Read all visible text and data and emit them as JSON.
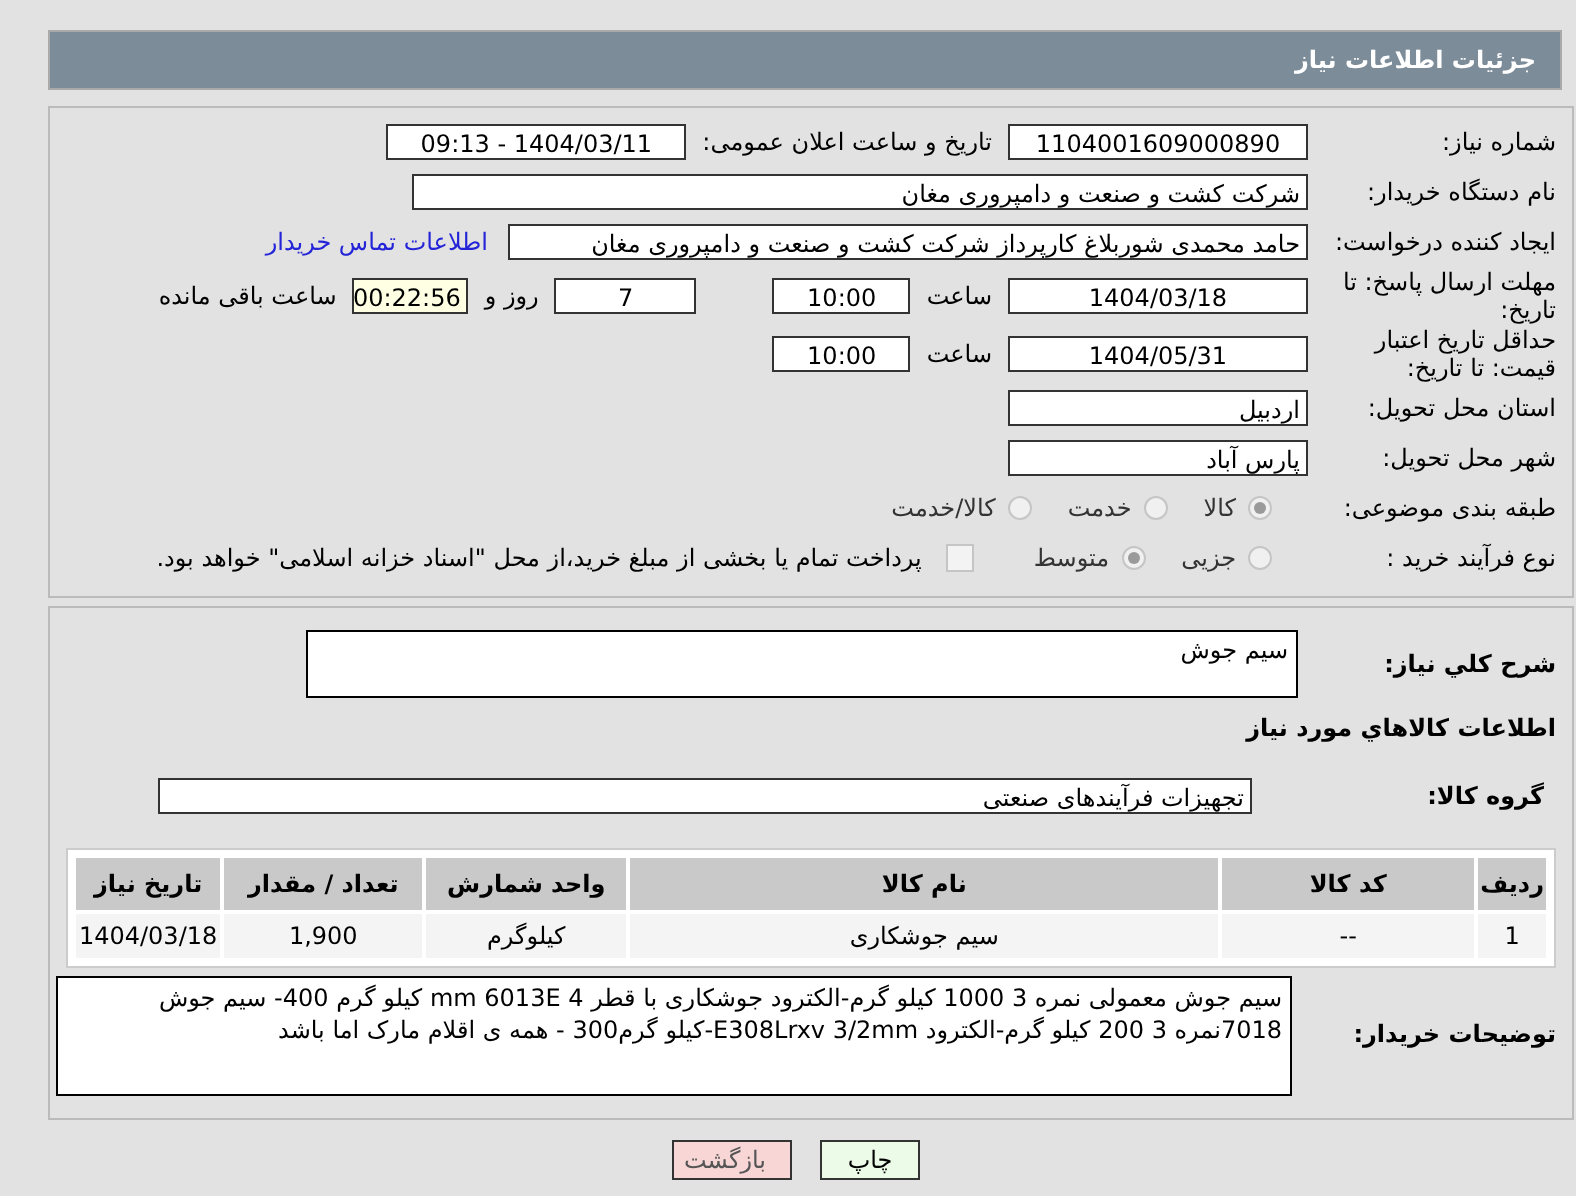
{
  "header": {
    "title": "جزئیات اطلاعات نیاز"
  },
  "need_number": {
    "label": "شماره نیاز:",
    "value": "1104001609000890"
  },
  "announce": {
    "label": "تاریخ و ساعت اعلان عمومی:",
    "value": "1404/03/11 - 09:13"
  },
  "buyer_org": {
    "label": "نام دستگاه خریدار:",
    "value": "شرکت کشت و صنعت و دامپروری مغان"
  },
  "requester": {
    "label": "ایجاد کننده درخواست:",
    "value": "حامد محمدی شوربلاغ کارپرداز شرکت کشت و صنعت و دامپروری مغان",
    "link": "اطلاعات تماس خریدار"
  },
  "deadline": {
    "label": "مهلت ارسال پاسخ: تا تاریخ:",
    "date": "1404/03/18",
    "time_label": "ساعت",
    "time": "10:00",
    "days": "7",
    "days_label": "روز و",
    "remaining": "00:22:56",
    "remaining_label": "ساعت باقی مانده"
  },
  "validity": {
    "label": "حداقل تاریخ اعتبار قیمت: تا تاریخ:",
    "date": "1404/05/31",
    "time_label": "ساعت",
    "time": "10:00"
  },
  "province": {
    "label": "استان محل تحویل:",
    "value": "اردبیل"
  },
  "city": {
    "label": "شهر محل تحویل:",
    "value": "پارس آباد"
  },
  "category": {
    "label": "طبقه بندی موضوعی:",
    "options": [
      {
        "label": "کالا",
        "selected": true
      },
      {
        "label": "خدمت",
        "selected": false
      },
      {
        "label": "کالا/خدمت",
        "selected": false
      }
    ]
  },
  "process": {
    "label": "نوع فرآیند خرید :",
    "options": [
      {
        "label": "جزیی",
        "selected": false
      },
      {
        "label": "متوسط",
        "selected": true
      }
    ],
    "payment": {
      "label": "پرداخت تمام یا بخشی از مبلغ خرید،از محل \"اسناد خزانه اسلامی\" خواهد بود.",
      "checked": false
    }
  },
  "summary": {
    "label": "شرح کلي نیاز:",
    "value": "سیم جوش"
  },
  "goods_heading": "اطلاعات کالاهاي مورد نیاز",
  "goods_group": {
    "label": "گروه کالا:",
    "value": "تجهیزات فرآیندهای صنعتی"
  },
  "table": {
    "columns": [
      "ردیف",
      "کد کالا",
      "نام کالا",
      "واحد شمارش",
      "تعداد / مقدار",
      "تاریخ نیاز"
    ],
    "rows": [
      [
        "1",
        "--",
        "سیم جوشکاری",
        "کیلوگرم",
        "1,900",
        "1404/03/18"
      ]
    ]
  },
  "buyer_notes": {
    "label": "توضیحات خریدار:",
    "value": "سیم جوش معمولی نمره 3 1000 کیلو گرم-الکترود جوشکاری با قطر 4 mm 6013E کیلو گرم 400- سیم جوش 7018نمره 3 200 کیلو گرم-الکترود E308Lrxv 3/2mm-کیلو گرم300 -  همه ی اقلام مارک اما باشد"
  },
  "buttons": [
    {
      "label": "چاپ",
      "kind": "print"
    },
    {
      "label": "بازگشت",
      "kind": "back"
    }
  ]
}
